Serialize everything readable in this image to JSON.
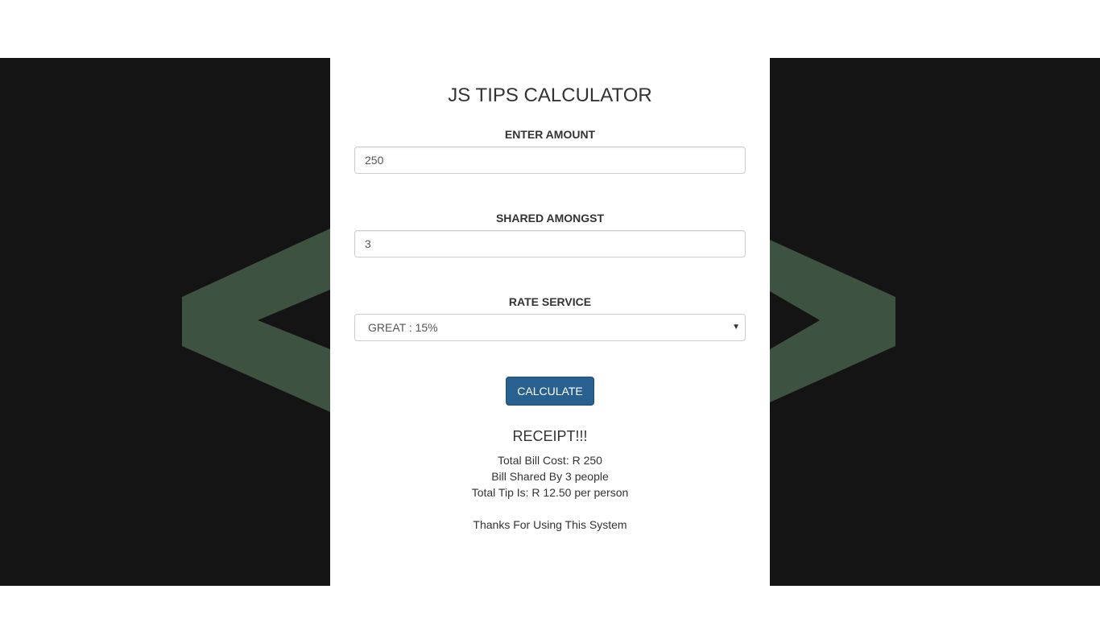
{
  "app": {
    "title": "JS TIPS CALCULATOR"
  },
  "form": {
    "amount_label": "ENTER AMOUNT",
    "amount_value": "250",
    "shared_label": "SHARED AMONGST",
    "shared_value": "3",
    "rate_label": "RATE SERVICE",
    "rate_selected": "GREAT : 15%",
    "calculate_label": "CALCULATE"
  },
  "receipt": {
    "title": "RECEIPT!!!",
    "total_bill": "Total Bill Cost: R 250",
    "shared_by": "Bill Shared By 3 people",
    "total_tip": "Total Tip Is: R 12.50 per person",
    "thanks": "Thanks For Using This System"
  },
  "colors": {
    "background": "#141414",
    "logo_green": "#3d5240",
    "button_blue": "#286090",
    "text": "#333333"
  },
  "icons": {
    "select_caret": "chevron-down-icon",
    "backdrop_logo": "code-brackets-icon"
  }
}
